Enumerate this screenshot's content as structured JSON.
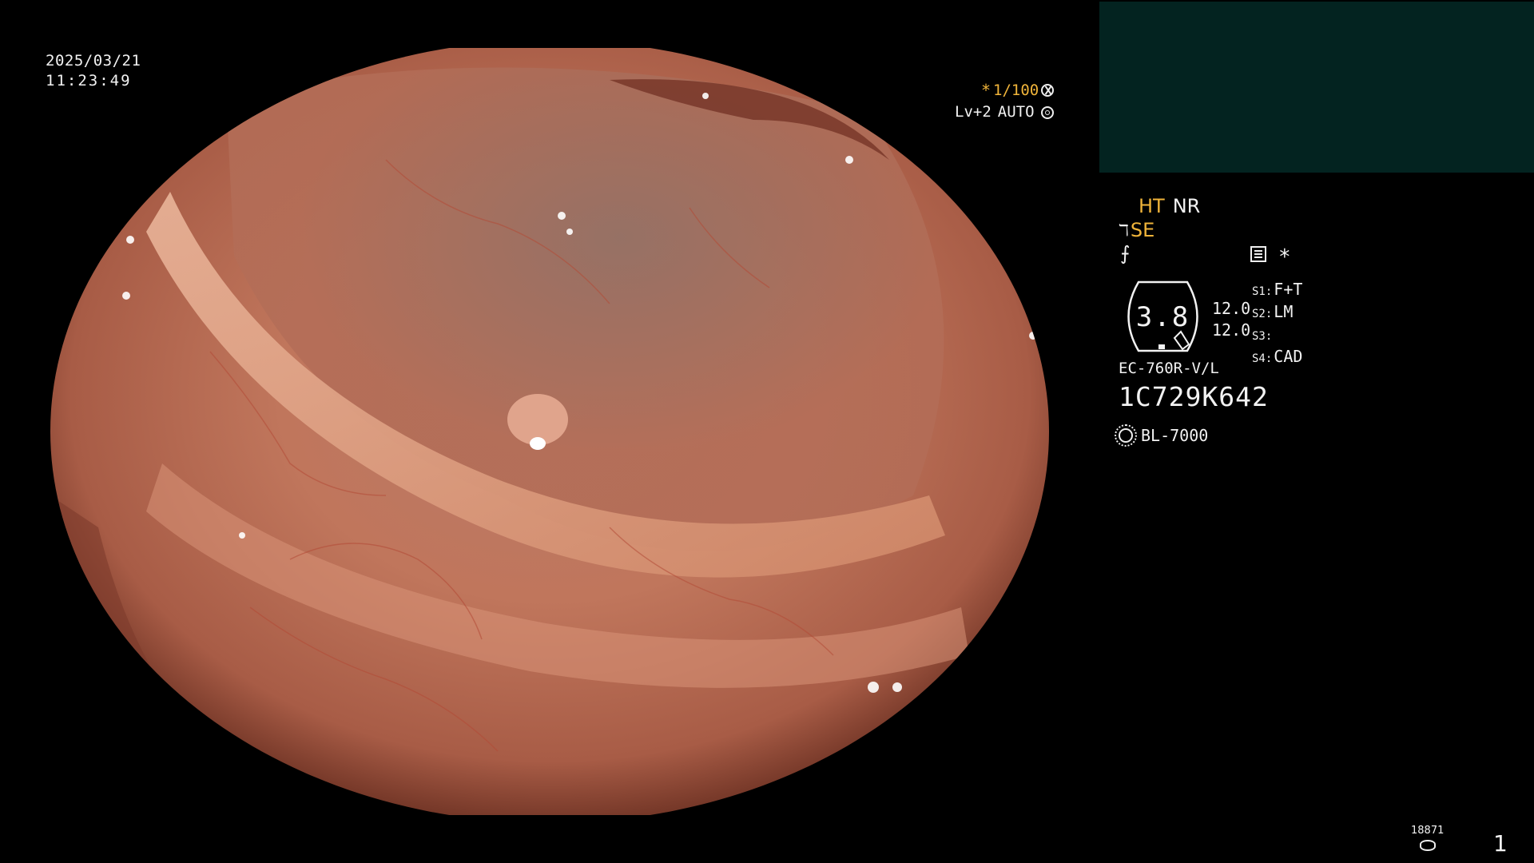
{
  "overlay": {
    "date": "2025/03/21",
    "time": "11:23:49",
    "shutter": {
      "prefix": "*",
      "value": "1/100"
    },
    "level": {
      "label": "Lv+2",
      "mode": "AUTO"
    }
  },
  "status": {
    "ht": "HT",
    "nr": "NR",
    "se": "SE",
    "zoom_value": "3.8",
    "values": [
      "12.0",
      "12.0"
    ],
    "slots": [
      {
        "key": "S1:",
        "value": "F+T"
      },
      {
        "key": "S2:",
        "value": "LM"
      },
      {
        "key": "S3:",
        "value": ""
      },
      {
        "key": "S4:",
        "value": "CAD"
      }
    ],
    "scope_model": "EC-760R-V/L",
    "scope_serial": "1C729K642",
    "light_source": "BL-7000",
    "counter": "18871",
    "page_number": "1"
  },
  "colors": {
    "background": "#000000",
    "pip": "#032320",
    "highlight": "#f0b43a",
    "text": "#f2f2f2",
    "mucosa": "#c27a5d"
  },
  "icons": [
    "shutter-icon",
    "aperture-icon",
    "scope-icon",
    "slash-icon",
    "menu-icon",
    "lamp-icon",
    "disk-icon"
  ]
}
